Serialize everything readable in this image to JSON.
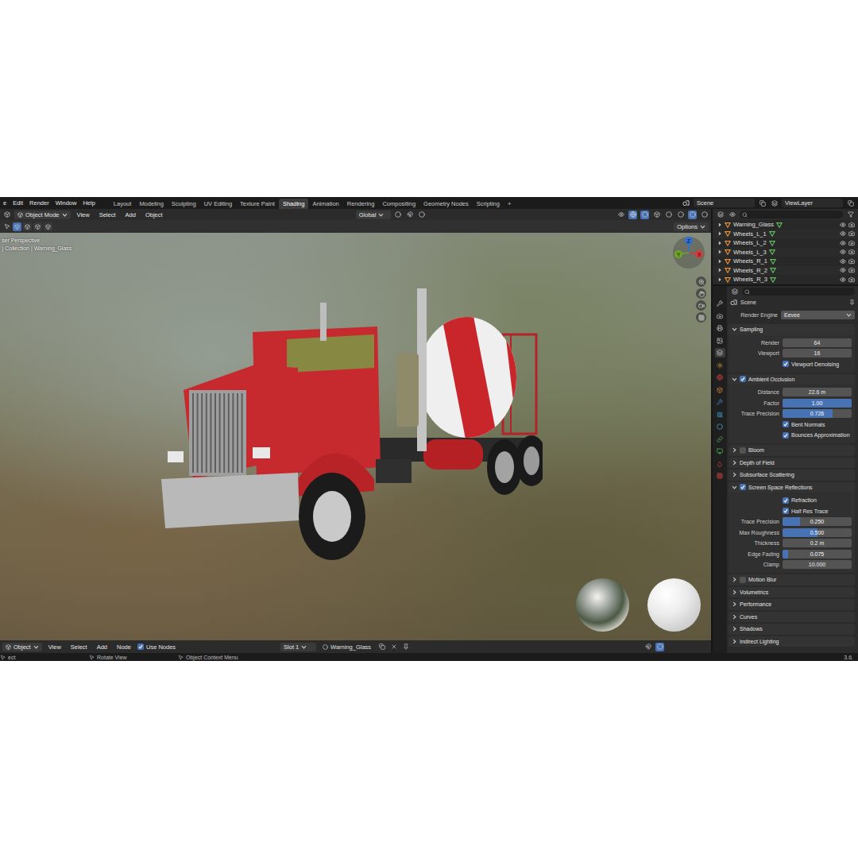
{
  "menu": [
    "e",
    "Edit",
    "Render",
    "Window",
    "Help"
  ],
  "workspaces": [
    {
      "label": "Layout",
      "selected": false
    },
    {
      "label": "Modeling",
      "selected": false
    },
    {
      "label": "Sculpting",
      "selected": false
    },
    {
      "label": "UV Editing",
      "selected": false
    },
    {
      "label": "Texture Paint",
      "selected": false
    },
    {
      "label": "Shading",
      "selected": true
    },
    {
      "label": "Animation",
      "selected": false
    },
    {
      "label": "Rendering",
      "selected": false
    },
    {
      "label": "Compositing",
      "selected": false
    },
    {
      "label": "Geometry Nodes",
      "selected": false
    },
    {
      "label": "Scripting",
      "selected": false
    }
  ],
  "add_workspace": "+",
  "scene": "Scene",
  "view_layer": "ViewLayer",
  "viewport_header": {
    "mode": "Object Mode",
    "menus": [
      "View",
      "Select",
      "Add",
      "Object"
    ],
    "orientation": "Global"
  },
  "tool_header": {
    "options": "Options"
  },
  "viewport": {
    "overlay": [
      "ser Perspective",
      ") Collection | Warning_Glass"
    ],
    "gizmo": [
      {
        "axis": "Z",
        "color": "#2f6fd6"
      },
      {
        "axis": "X",
        "color": "#d63a3a"
      },
      {
        "axis": "Y",
        "color": "#6ea823"
      }
    ]
  },
  "node_header": {
    "editor": "Object",
    "menus": [
      "View",
      "Select",
      "Add",
      "Node"
    ],
    "use_nodes": {
      "label": "Use Nodes",
      "checked": true
    },
    "slot": "Slot 1",
    "material": "Warning_Glass"
  },
  "status_bar": {
    "items": [
      "ect",
      "Rotate View",
      "Object Context Menu"
    ],
    "version": "3.6."
  },
  "outliner": {
    "rows": [
      {
        "name": "Warning_Glass"
      },
      {
        "name": "Wheels_L_1"
      },
      {
        "name": "Wheels_L_2"
      },
      {
        "name": "Wheels_L_3"
      },
      {
        "name": "Wheels_R_1"
      },
      {
        "name": "Wheels_R_2"
      },
      {
        "name": "Wheels_R_3"
      }
    ]
  },
  "properties": {
    "breadcrumb": "Scene",
    "render_engine": {
      "label": "Render Engine",
      "value": "Eevee"
    },
    "panels": [
      {
        "title": "Sampling",
        "kind": "plain",
        "checked": false,
        "expanded": true,
        "rows": [
          {
            "kind": "field",
            "label": "Render",
            "value": "64"
          },
          {
            "kind": "field",
            "label": "Viewport",
            "value": "16"
          },
          {
            "kind": "check",
            "label": "Viewport Denoising",
            "checked": true
          }
        ]
      },
      {
        "title": "Ambient Occlusion",
        "kind": "toggle",
        "checked": true,
        "expanded": true,
        "rows": [
          {
            "kind": "field",
            "label": "Distance",
            "value": "22.6 m"
          },
          {
            "kind": "slider",
            "label": "Factor",
            "value": "1.00",
            "level": 1
          },
          {
            "kind": "slider",
            "label": "Trace Precision",
            "value": "0.726",
            "level": 0.726
          },
          {
            "kind": "check",
            "label": "Bent Normals",
            "checked": true
          },
          {
            "kind": "check",
            "label": "Bounces Approximation",
            "checked": true
          }
        ]
      },
      {
        "title": "Bloom",
        "kind": "toggle",
        "checked": false,
        "expanded": false,
        "rows": []
      },
      {
        "title": "Depth of Field",
        "kind": "plain",
        "checked": false,
        "expanded": false,
        "rows": []
      },
      {
        "title": "Subsurface Scattering",
        "kind": "plain",
        "checked": false,
        "expanded": false,
        "rows": []
      },
      {
        "title": "Screen Space Reflections",
        "kind": "toggle",
        "checked": true,
        "expanded": true,
        "rows": [
          {
            "kind": "check",
            "label": "Refraction",
            "checked": true
          },
          {
            "kind": "check",
            "label": "Half Res Trace",
            "checked": true
          },
          {
            "kind": "slider",
            "label": "Trace Precision",
            "value": "0.250",
            "level": 0.25
          },
          {
            "kind": "slider",
            "label": "Max Roughness",
            "value": "0.500",
            "level": 0.5
          },
          {
            "kind": "field",
            "label": "Thickness",
            "value": "0.2 m"
          },
          {
            "kind": "slider",
            "label": "Edge Fading",
            "value": "0.075",
            "level": 0.075
          },
          {
            "kind": "field",
            "label": "Clamp",
            "value": "10.000"
          }
        ]
      },
      {
        "title": "Motion Blur",
        "kind": "toggle",
        "checked": false,
        "expanded": false,
        "rows": []
      },
      {
        "title": "Volumetrics",
        "kind": "plain",
        "checked": false,
        "expanded": false,
        "rows": []
      },
      {
        "title": "Performance",
        "kind": "plain",
        "checked": false,
        "expanded": false,
        "rows": []
      },
      {
        "title": "Curves",
        "kind": "plain",
        "checked": false,
        "expanded": false,
        "rows": []
      },
      {
        "title": "Shadows",
        "kind": "plain",
        "checked": false,
        "expanded": false,
        "rows": []
      },
      {
        "title": "Indirect Lighting",
        "kind": "plain",
        "checked": false,
        "expanded": false,
        "rows": []
      }
    ]
  }
}
